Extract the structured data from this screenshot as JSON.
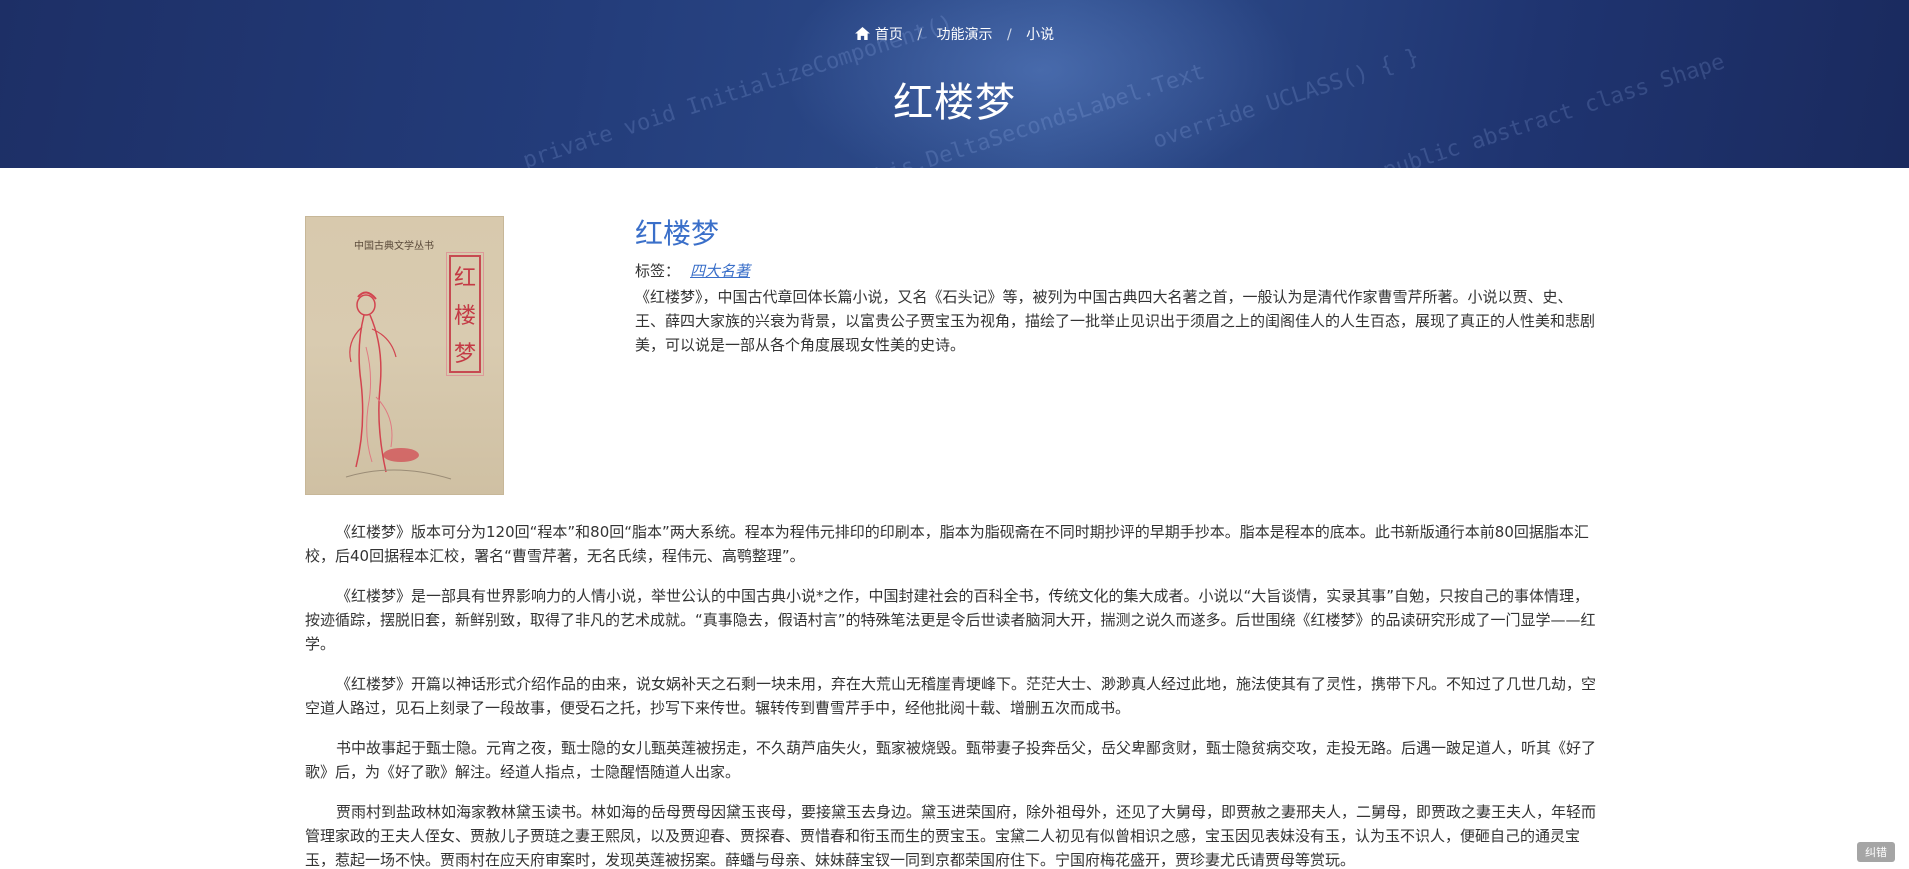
{
  "breadcrumb": {
    "home": "首页",
    "level2": "功能演示",
    "level3": "小说"
  },
  "header": {
    "title": "红楼梦"
  },
  "book": {
    "title": "红楼梦",
    "tag_label": "标签：",
    "tag": "四大名著",
    "intro": "《红楼梦》，中国古代章回体长篇小说，又名《石头记》等，被列为中国古典四大名著之首，一般认为是清代作家曹雪芹所著。小说以贾、史、王、薛四大家族的兴衰为背景，以富贵公子贾宝玉为视角，描绘了一批举止见识出于须眉之上的闺阁佳人的人生百态，展现了真正的人性美和悲剧美，可以说是一部从各个角度展现女性美的史诗。",
    "cover": {
      "series": "中国古典文学丛书",
      "title_chars": [
        "红",
        "楼",
        "梦"
      ]
    }
  },
  "paragraphs": [
    "《红楼梦》版本可分为120回“程本”和80回“脂本”两大系统。程本为程伟元排印的印刷本，脂本为脂砚斋在不同时期抄评的早期手抄本。脂本是程本的底本。此书新版通行本前80回据脂本汇校，后40回据程本汇校，署名“曹雪芹著，无名氏续，程伟元、高鹗整理”。",
    "《红楼梦》是一部具有世界影响力的人情小说，举世公认的中国古典小说*之作，中国封建社会的百科全书，传统文化的集大成者。小说以“大旨谈情，实录其事”自勉，只按自己的事体情理，按迹循踪，摆脱旧套，新鲜别致，取得了非凡的艺术成就。“真事隐去，假语村言”的特殊笔法更是令后世读者脑洞大开，揣测之说久而遂多。后世围绕《红楼梦》的品读研究形成了一门显学——红学。",
    "《红楼梦》开篇以神话形式介绍作品的由来，说女娲补天之石剩一块未用，弃在大荒山无稽崖青埂峰下。茫茫大士、渺渺真人经过此地，施法使其有了灵性，携带下凡。不知过了几世几劫，空空道人路过，见石上刻录了一段故事，便受石之托，抄写下来传世。辗转传到曹雪芹手中，经他批阅十载、增删五次而成书。",
    "书中故事起于甄士隐。元宵之夜，甄士隐的女儿甄英莲被拐走，不久葫芦庙失火，甄家被烧毁。甄带妻子投奔岳父，岳父卑鄙贪财，甄士隐贫病交攻，走投无路。后遇一跛足道人，听其《好了歌》后，为《好了歌》解注。经道人指点，士隐醒悟随道人出家。",
    "贾雨村到盐政林如海家教林黛玉读书。林如海的岳母贾母因黛玉丧母，要接黛玉去身边。黛玉进荣国府，除外祖母外，还见了大舅母，即贾赦之妻邢夫人，二舅母，即贾政之妻王夫人，年轻而管理家政的王夫人侄女、贾赦儿子贾琏之妻王熙凤，以及贾迎春、贾探春、贾惜春和衔玉而生的贾宝玉。宝黛二人初见有似曾相识之感，宝玉因见表妹没有玉，认为玉不识人，便砸自己的通灵宝玉，惹起一场不快。贾雨村在应天府审案时，发现英莲被拐案。薛蟠与母亲、妹妹薛宝钗一同到京都荣国府住下。宁国府梅花盛开，贾珍妻尤氏请贾母等赏玩。"
  ],
  "feedback": "纠错",
  "colors": {
    "accent": "#3a6fc9",
    "banner": "#233c7a"
  }
}
